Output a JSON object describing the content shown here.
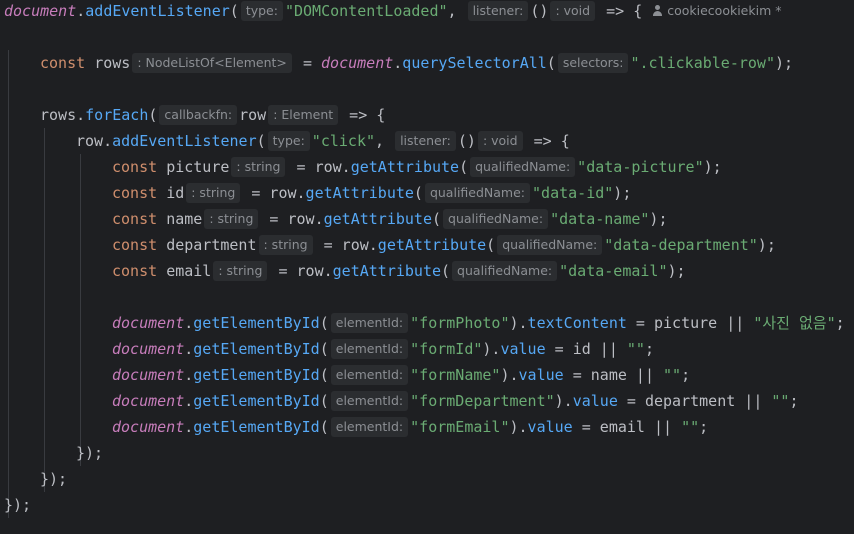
{
  "editor": {
    "language": "javascript",
    "author_hint": "cookiecookiekim *",
    "lines": [
      {
        "indent": 0,
        "tokens": [
          {
            "t": "glob",
            "v": "document"
          },
          {
            "t": "op",
            "v": "."
          },
          {
            "t": "fn",
            "v": "addEventListener"
          },
          {
            "t": "op",
            "v": "("
          },
          {
            "t": "hint",
            "v": "type:"
          },
          {
            "t": "str",
            "v": "\"DOMContentLoaded\""
          },
          {
            "t": "op",
            "v": ", "
          },
          {
            "t": "hint",
            "v": "listener:"
          },
          {
            "t": "op",
            "v": "()"
          },
          {
            "t": "hint",
            "v": ": void"
          },
          {
            "t": "op",
            "v": " => {"
          },
          {
            "t": "author",
            "v": "cookiecookiekim *"
          }
        ]
      },
      {
        "indent": 0,
        "tokens": []
      },
      {
        "indent": 1,
        "tokens": [
          {
            "t": "kw",
            "v": "const "
          },
          {
            "t": "var",
            "v": "rows"
          },
          {
            "t": "hint",
            "v": ": NodeListOf<Element>"
          },
          {
            "t": "op",
            "v": " = "
          },
          {
            "t": "glob",
            "v": "document"
          },
          {
            "t": "op",
            "v": "."
          },
          {
            "t": "fn",
            "v": "querySelectorAll"
          },
          {
            "t": "op",
            "v": "("
          },
          {
            "t": "hint",
            "v": "selectors:"
          },
          {
            "t": "str",
            "v": "\".clickable-row\""
          },
          {
            "t": "op",
            "v": ");"
          }
        ]
      },
      {
        "indent": 0,
        "tokens": []
      },
      {
        "indent": 1,
        "tokens": [
          {
            "t": "var",
            "v": "rows"
          },
          {
            "t": "op",
            "v": "."
          },
          {
            "t": "fn",
            "v": "forEach"
          },
          {
            "t": "op",
            "v": "("
          },
          {
            "t": "hint",
            "v": "callbackfn:"
          },
          {
            "t": "var",
            "v": "row"
          },
          {
            "t": "hint",
            "v": ": Element"
          },
          {
            "t": "op",
            "v": " => {"
          }
        ]
      },
      {
        "indent": 2,
        "tokens": [
          {
            "t": "var",
            "v": "row"
          },
          {
            "t": "op",
            "v": "."
          },
          {
            "t": "fn",
            "v": "addEventListener"
          },
          {
            "t": "op",
            "v": "("
          },
          {
            "t": "hint",
            "v": "type:"
          },
          {
            "t": "str",
            "v": "\"click\""
          },
          {
            "t": "op",
            "v": ", "
          },
          {
            "t": "hint",
            "v": "listener:"
          },
          {
            "t": "op",
            "v": "()"
          },
          {
            "t": "hint",
            "v": ": void"
          },
          {
            "t": "op",
            "v": " => {"
          }
        ]
      },
      {
        "indent": 3,
        "tokens": [
          {
            "t": "kw",
            "v": "const "
          },
          {
            "t": "var",
            "v": "picture"
          },
          {
            "t": "hint",
            "v": ": string"
          },
          {
            "t": "op",
            "v": " = row."
          },
          {
            "t": "fn",
            "v": "getAttribute"
          },
          {
            "t": "op",
            "v": "("
          },
          {
            "t": "hint",
            "v": "qualifiedName:"
          },
          {
            "t": "str",
            "v": "\"data-picture\""
          },
          {
            "t": "op",
            "v": ");"
          }
        ]
      },
      {
        "indent": 3,
        "tokens": [
          {
            "t": "kw",
            "v": "const "
          },
          {
            "t": "var",
            "v": "id"
          },
          {
            "t": "hint",
            "v": ": string"
          },
          {
            "t": "op",
            "v": " = row."
          },
          {
            "t": "fn",
            "v": "getAttribute"
          },
          {
            "t": "op",
            "v": "("
          },
          {
            "t": "hint",
            "v": "qualifiedName:"
          },
          {
            "t": "str",
            "v": "\"data-id\""
          },
          {
            "t": "op",
            "v": ");"
          }
        ]
      },
      {
        "indent": 3,
        "tokens": [
          {
            "t": "kw",
            "v": "const "
          },
          {
            "t": "var",
            "v": "name"
          },
          {
            "t": "hint",
            "v": ": string"
          },
          {
            "t": "op",
            "v": " = row."
          },
          {
            "t": "fn",
            "v": "getAttribute"
          },
          {
            "t": "op",
            "v": "("
          },
          {
            "t": "hint",
            "v": "qualifiedName:"
          },
          {
            "t": "str",
            "v": "\"data-name\""
          },
          {
            "t": "op",
            "v": ");"
          }
        ]
      },
      {
        "indent": 3,
        "tokens": [
          {
            "t": "kw",
            "v": "const "
          },
          {
            "t": "var",
            "v": "department"
          },
          {
            "t": "hint",
            "v": ": string"
          },
          {
            "t": "op",
            "v": " = row."
          },
          {
            "t": "fn",
            "v": "getAttribute"
          },
          {
            "t": "op",
            "v": "("
          },
          {
            "t": "hint",
            "v": "qualifiedName:"
          },
          {
            "t": "str",
            "v": "\"data-department\""
          },
          {
            "t": "op",
            "v": ");"
          }
        ]
      },
      {
        "indent": 3,
        "tokens": [
          {
            "t": "kw",
            "v": "const "
          },
          {
            "t": "var",
            "v": "email"
          },
          {
            "t": "hint",
            "v": ": string"
          },
          {
            "t": "op",
            "v": " = row."
          },
          {
            "t": "fn",
            "v": "getAttribute"
          },
          {
            "t": "op",
            "v": "("
          },
          {
            "t": "hint",
            "v": "qualifiedName:"
          },
          {
            "t": "str",
            "v": "\"data-email\""
          },
          {
            "t": "op",
            "v": ");"
          }
        ]
      },
      {
        "indent": 0,
        "tokens": []
      },
      {
        "indent": 3,
        "tokens": [
          {
            "t": "glob",
            "v": "document"
          },
          {
            "t": "op",
            "v": "."
          },
          {
            "t": "fn",
            "v": "getElementById"
          },
          {
            "t": "op",
            "v": "("
          },
          {
            "t": "hint",
            "v": "elementId:"
          },
          {
            "t": "str",
            "v": "\"formPhoto\""
          },
          {
            "t": "op",
            "v": ")."
          },
          {
            "t": "prop",
            "v": "textContent"
          },
          {
            "t": "op",
            "v": " = picture || "
          },
          {
            "t": "str",
            "v": "\"사진 없음\""
          },
          {
            "t": "op",
            "v": ";"
          }
        ]
      },
      {
        "indent": 3,
        "tokens": [
          {
            "t": "glob",
            "v": "document"
          },
          {
            "t": "op",
            "v": "."
          },
          {
            "t": "fn",
            "v": "getElementById"
          },
          {
            "t": "op",
            "v": "("
          },
          {
            "t": "hint",
            "v": "elementId:"
          },
          {
            "t": "str",
            "v": "\"formId\""
          },
          {
            "t": "op",
            "v": ")."
          },
          {
            "t": "prop",
            "v": "value"
          },
          {
            "t": "op",
            "v": " = id || "
          },
          {
            "t": "str",
            "v": "\"\""
          },
          {
            "t": "op",
            "v": ";"
          }
        ]
      },
      {
        "indent": 3,
        "tokens": [
          {
            "t": "glob",
            "v": "document"
          },
          {
            "t": "op",
            "v": "."
          },
          {
            "t": "fn",
            "v": "getElementById"
          },
          {
            "t": "op",
            "v": "("
          },
          {
            "t": "hint",
            "v": "elementId:"
          },
          {
            "t": "str",
            "v": "\"formName\""
          },
          {
            "t": "op",
            "v": ")."
          },
          {
            "t": "prop",
            "v": "value"
          },
          {
            "t": "op",
            "v": " = name || "
          },
          {
            "t": "str",
            "v": "\"\""
          },
          {
            "t": "op",
            "v": ";"
          }
        ]
      },
      {
        "indent": 3,
        "tokens": [
          {
            "t": "glob",
            "v": "document"
          },
          {
            "t": "op",
            "v": "."
          },
          {
            "t": "fn",
            "v": "getElementById"
          },
          {
            "t": "op",
            "v": "("
          },
          {
            "t": "hint",
            "v": "elementId:"
          },
          {
            "t": "str",
            "v": "\"formDepartment\""
          },
          {
            "t": "op",
            "v": ")."
          },
          {
            "t": "prop",
            "v": "value"
          },
          {
            "t": "op",
            "v": " = department || "
          },
          {
            "t": "str",
            "v": "\"\""
          },
          {
            "t": "op",
            "v": ";"
          }
        ]
      },
      {
        "indent": 3,
        "tokens": [
          {
            "t": "glob",
            "v": "document"
          },
          {
            "t": "op",
            "v": "."
          },
          {
            "t": "fn",
            "v": "getElementById"
          },
          {
            "t": "op",
            "v": "("
          },
          {
            "t": "hint",
            "v": "elementId:"
          },
          {
            "t": "str",
            "v": "\"formEmail\""
          },
          {
            "t": "op",
            "v": ")."
          },
          {
            "t": "prop",
            "v": "value"
          },
          {
            "t": "op",
            "v": " = email || "
          },
          {
            "t": "str",
            "v": "\"\""
          },
          {
            "t": "op",
            "v": ";"
          }
        ]
      },
      {
        "indent": 2,
        "tokens": [
          {
            "t": "op",
            "v": "});"
          }
        ]
      },
      {
        "indent": 1,
        "tokens": [
          {
            "t": "op",
            "v": "});"
          }
        ]
      },
      {
        "indent": 0,
        "tokens": [
          {
            "t": "op",
            "v": "});"
          }
        ]
      }
    ]
  },
  "colors": {
    "background": "#1e1f22",
    "default_text": "#bcbec4",
    "keyword": "#cf8e6d",
    "string": "#6aab73",
    "function": "#56a8f5",
    "global": "#c77dbb",
    "hint_bg": "#2b2d30",
    "hint_text": "#8c8f94"
  }
}
